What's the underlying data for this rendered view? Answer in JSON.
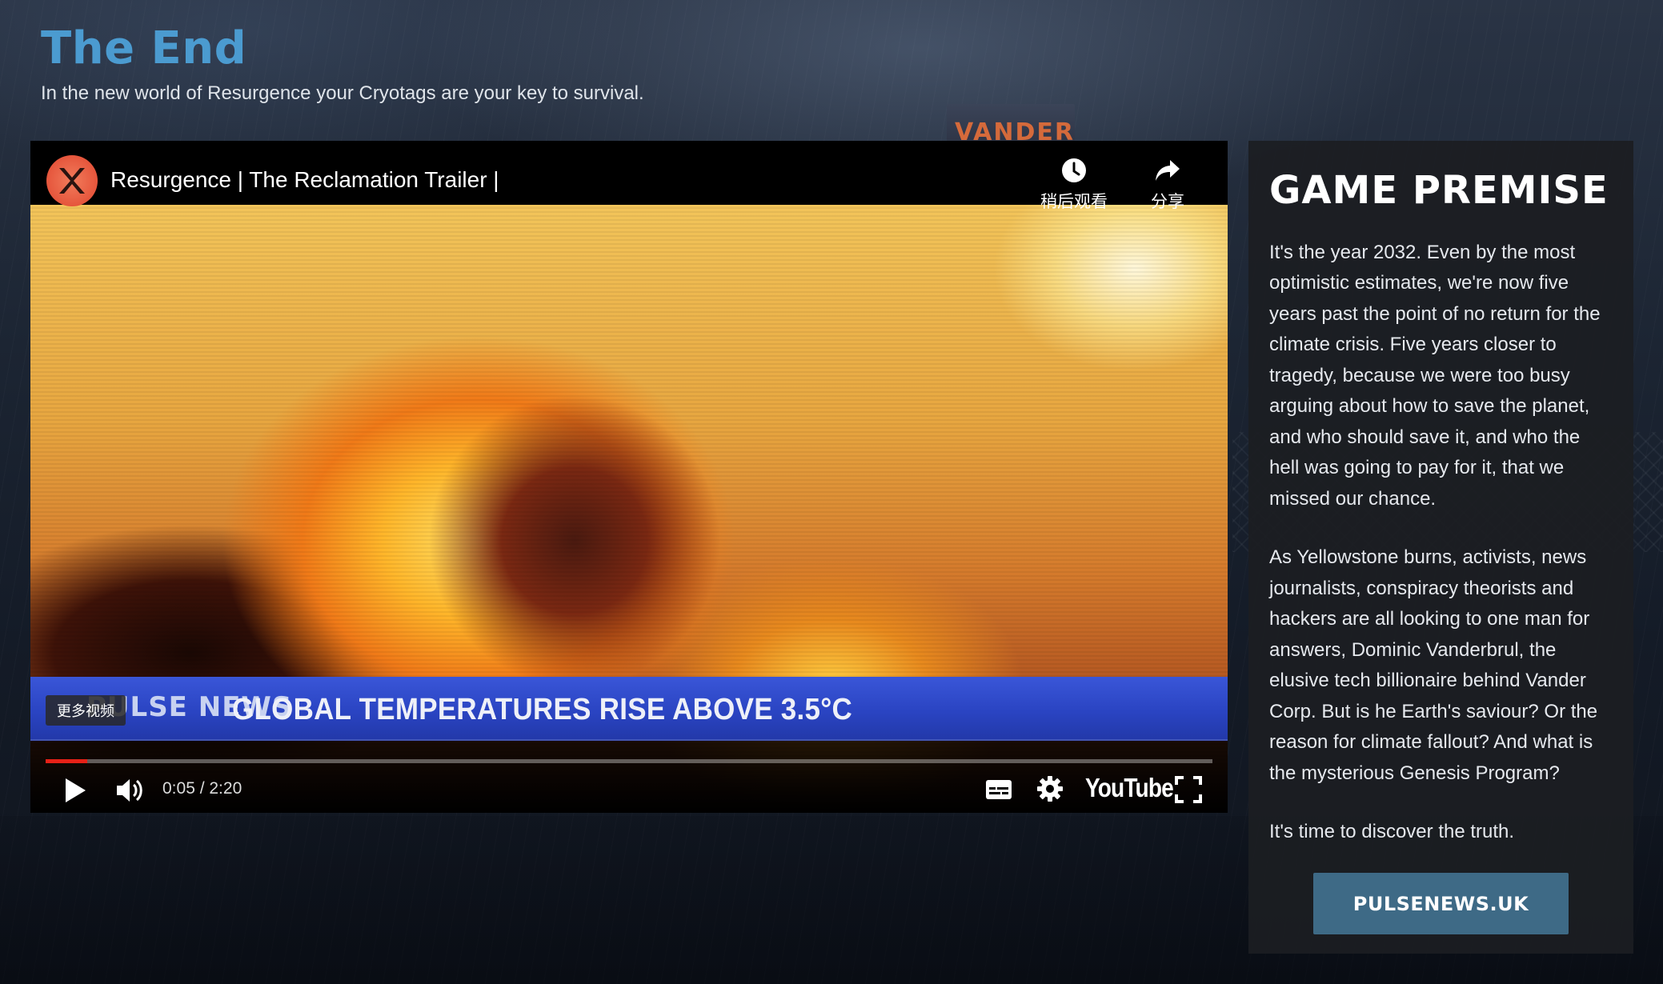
{
  "page": {
    "title": "The End",
    "subtitle": "In the new world of Resurgence your Cryotags are your key to survival."
  },
  "background": {
    "sign_text": "VANDER"
  },
  "player": {
    "video_title": "Resurgence | The Reclamation Trailer |",
    "watch_later_label": "稍后观看",
    "share_label": "分享",
    "more_videos_label": "更多视频",
    "news_logo": "PULSE NEWS",
    "news_headline": "GLOBAL TEMPERATURES RISE ABOVE 3.5°C",
    "time_readout": "0:05 / 2:20",
    "progress": 0.036,
    "brand": "YouTube",
    "icons": [
      "play-icon",
      "volume-icon",
      "subtitles-icon",
      "settings-icon",
      "fullscreen-icon",
      "clock-icon",
      "share-icon"
    ]
  },
  "sidebar": {
    "title": "GAME PREMISE",
    "paragraphs": [
      "It's the year 2032. Even by the most optimistic estimates, we're now five years past the point of no return for the climate crisis. Five years closer to tragedy, because we were too busy arguing about how to save the planet, and who should save it, and who the hell was going to pay for it, that we missed our chance.",
      "As Yellowstone burns, activists, news journalists, conspiracy theorists and hackers are all looking to one man for answers, Dominic Vanderbrul, the elusive tech billionaire behind Vander Corp. But is he Earth's saviour? Or the reason for climate fallout? And what is the mysterious Genesis Program?",
      "It's time to discover the truth."
    ],
    "button_label": "PULSENEWS.UK"
  },
  "colors": {
    "title_blue": "#4b9bd0",
    "button_blue": "#3e6a86",
    "progress_red": "#e62117",
    "banner_blue": "#2a44c2"
  }
}
